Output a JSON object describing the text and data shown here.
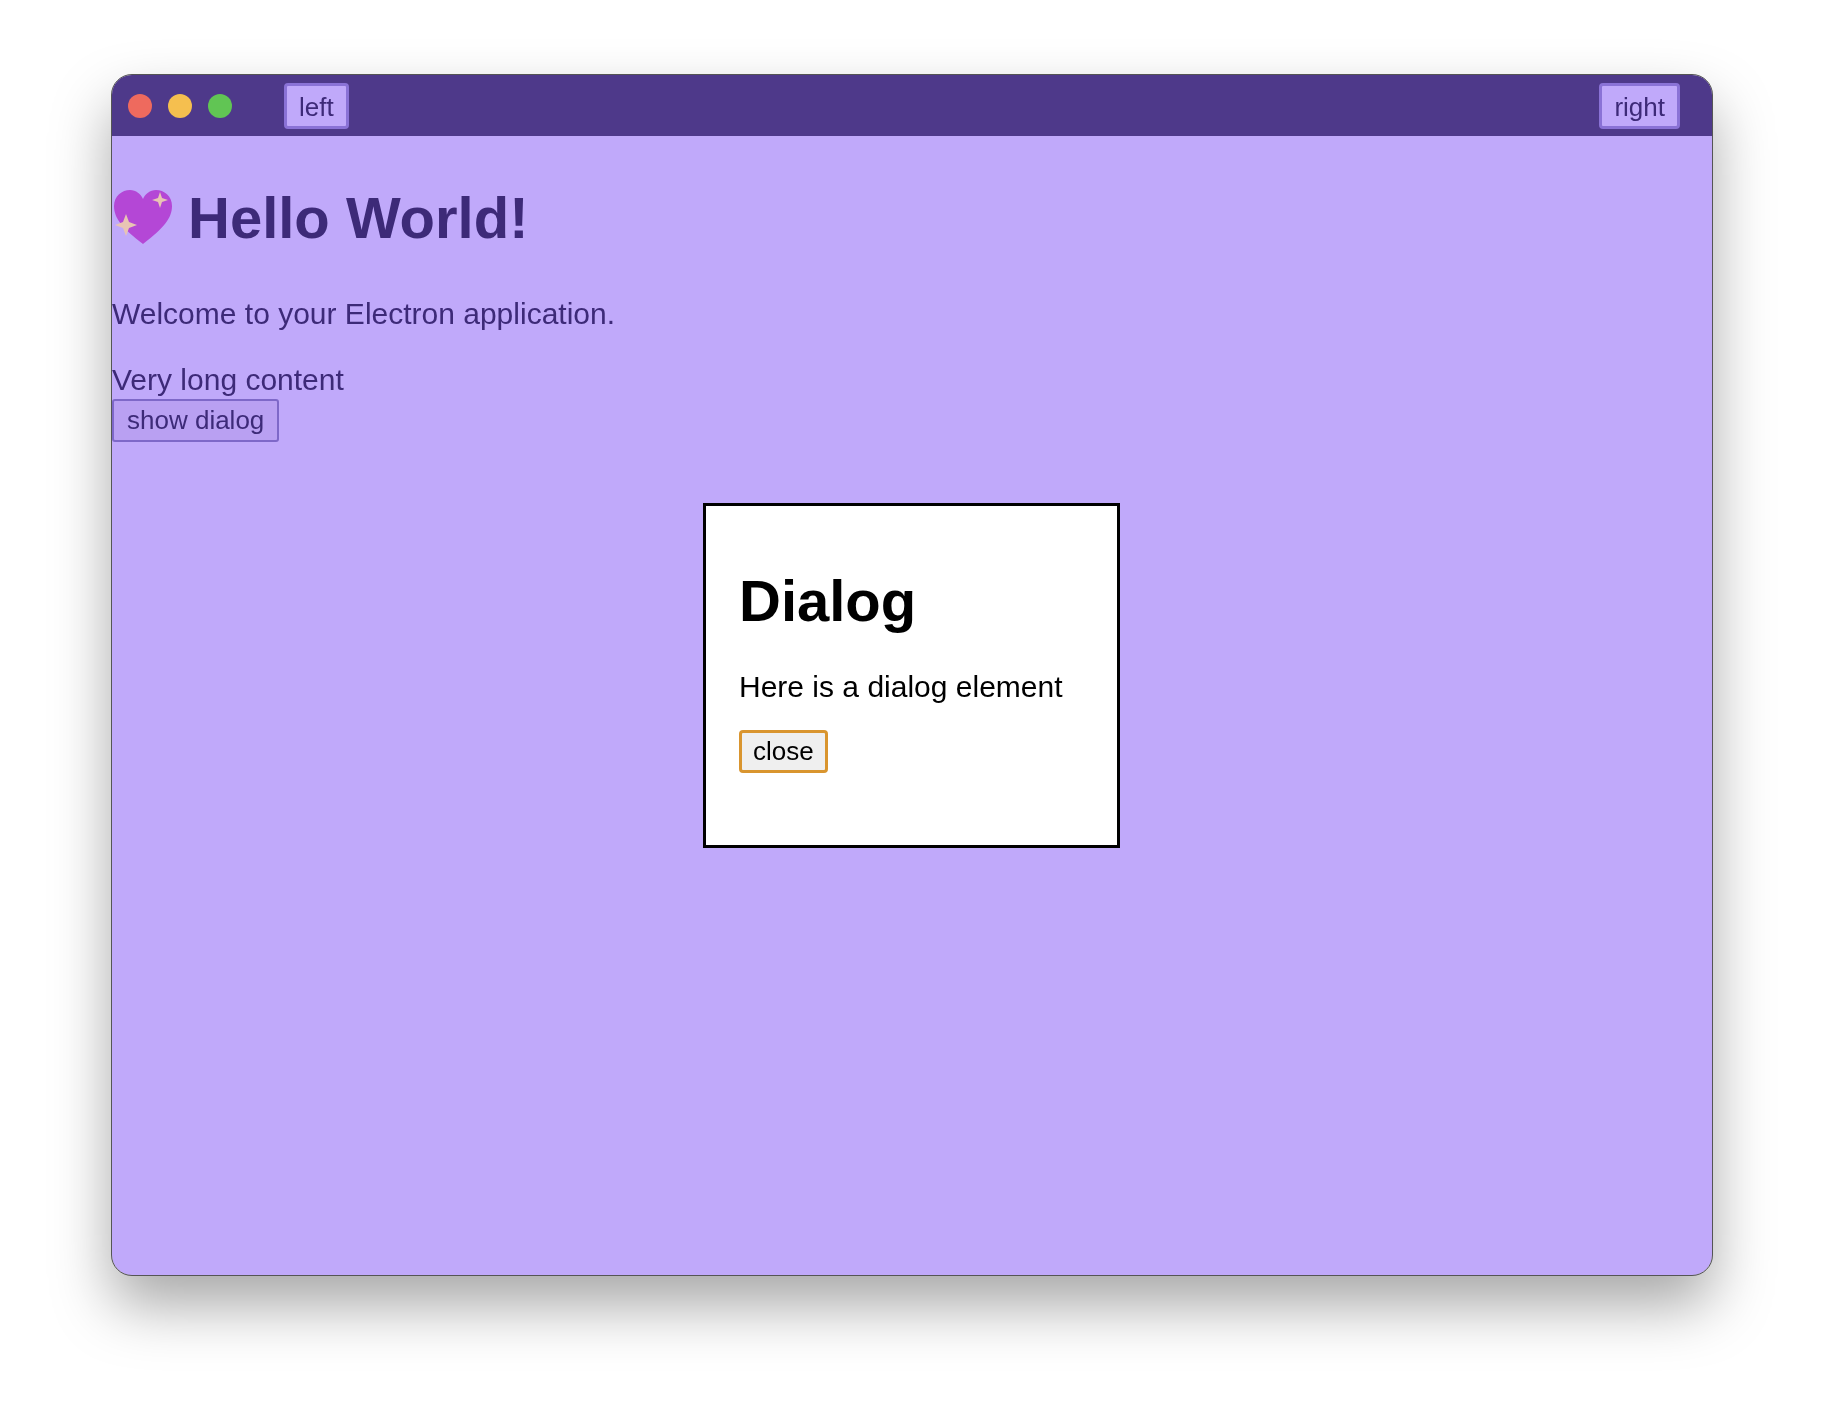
{
  "window": {
    "toolbar_buttons": [
      {
        "label": "left",
        "kind": "left"
      },
      {
        "label": "right",
        "kind": "right"
      }
    ]
  },
  "content": {
    "heading": "Hello World!",
    "paragraphs": [
      "Welcome to your Electron application.",
      "Very long content"
    ],
    "button": "show dialog"
  },
  "dialog": {
    "title": "Dialog",
    "text": "Here is a dialog element",
    "button": {
      "label": "close",
      "focused": true
    }
  }
}
